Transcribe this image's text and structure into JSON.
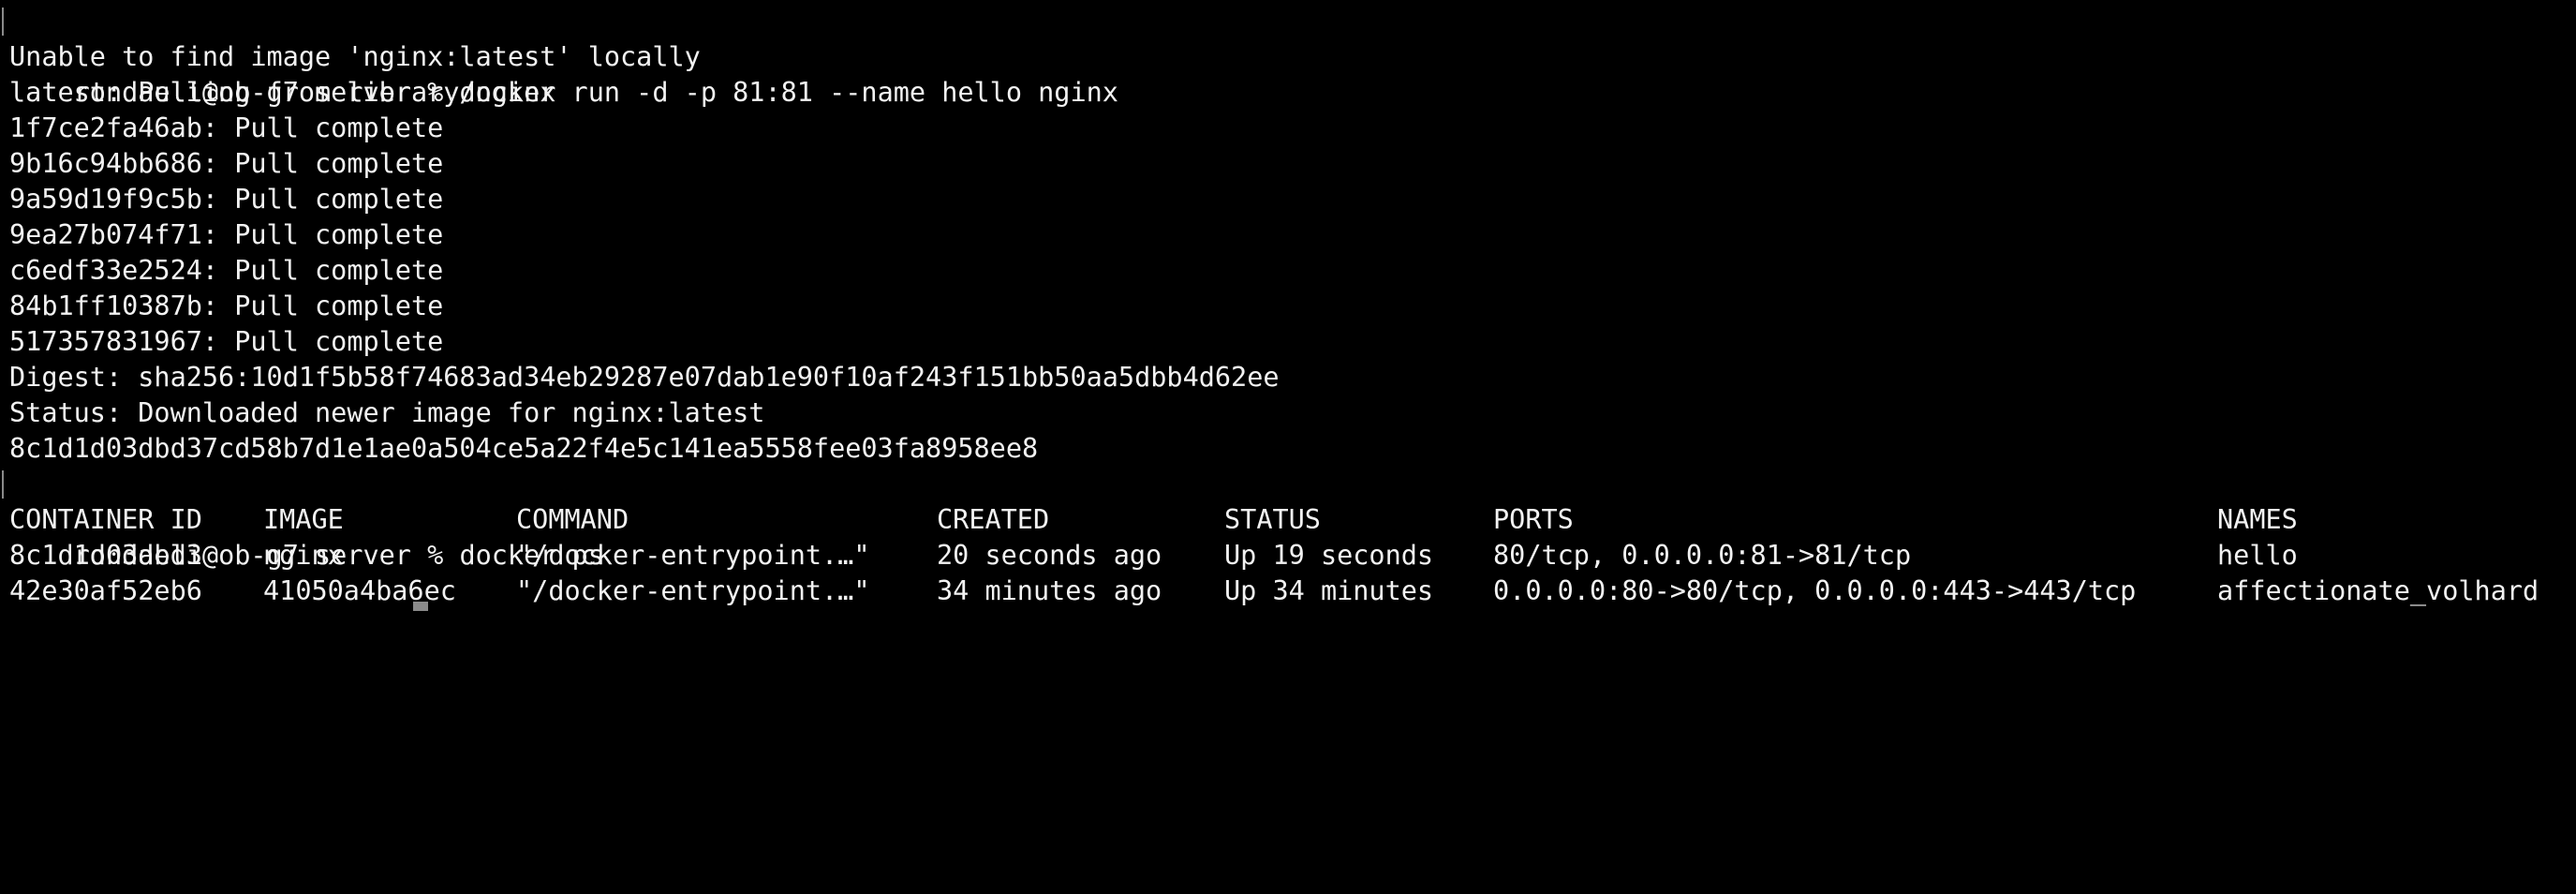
{
  "terminal": {
    "lines": {
      "l0": "rondaeli@ob-g7 server % docker run -d -p 81:81 --name hello nginx",
      "l1": "Unable to find image 'nginx:latest' locally",
      "l2": "latest: Pulling from library/nginx",
      "l3": "1f7ce2fa46ab: Pull complete",
      "l4": "9b16c94bb686: Pull complete",
      "l5": "9a59d19f9c5b: Pull complete",
      "l6": "9ea27b074f71: Pull complete",
      "l7": "c6edf33e2524: Pull complete",
      "l8": "84b1ff10387b: Pull complete",
      "l9": "517357831967: Pull complete",
      "l10": "Digest: sha256:10d1f5b58f74683ad34eb29287e07dab1e90f10af243f151bb50aa5dbb4d62ee",
      "l11": "Status: Downloaded newer image for nginx:latest",
      "l12": "8c1d1d03dbd37cd58b7d1e1ae0a504ce5a22f4e5c141ea5558fee03fa8958ee8",
      "l13": "rondaeli@ob-g7 server % docker ps"
    },
    "ps_table": {
      "headers": {
        "container_id": "CONTAINER ID",
        "image": "IMAGE",
        "command": "COMMAND",
        "created": "CREATED",
        "status": "STATUS",
        "ports": "PORTS",
        "names": "NAMES"
      },
      "rows": [
        {
          "container_id": "8c1d1d03dbd3",
          "image": "nginx",
          "command": "\"/docker-entrypoint.…\"",
          "created": "20 seconds ago",
          "status": "Up 19 seconds",
          "ports": "80/tcp, 0.0.0.0:81->81/tcp",
          "names": "hello"
        },
        {
          "container_id": "42e30af52eb6",
          "image": "41050a4ba6ec",
          "command": "\"/docker-entrypoint.…\"",
          "created": "34 minutes ago",
          "status": "Up 34 minutes",
          "ports": "0.0.0.0:80->80/tcp, 0.0.0.0:443->443/tcp",
          "names": "affectionate_volhard"
        }
      ]
    },
    "colors": {
      "background": "#000000",
      "foreground": "#f2f2f2",
      "prompt_marker": "#8a8a8a"
    }
  }
}
